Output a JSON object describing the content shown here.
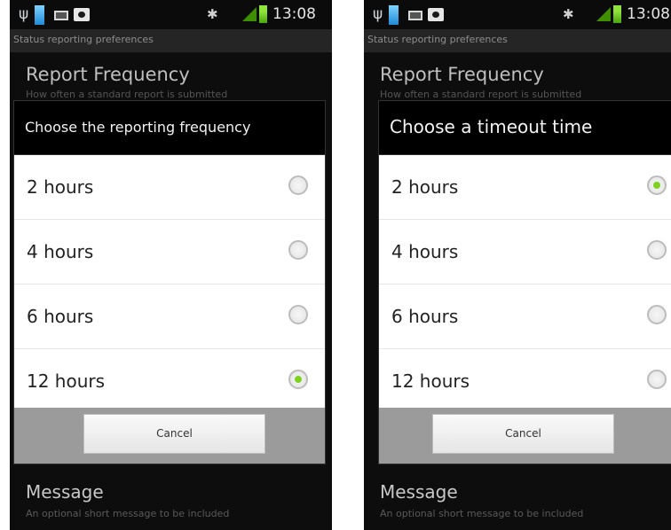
{
  "statusbar": {
    "time": "13:08"
  },
  "screen": {
    "app_title": "Status reporting preferences",
    "pref_title": "Report Frequency",
    "pref_summary": "How often a standard report is submitted",
    "message_title": "Message",
    "message_summary": "An optional short message to be included"
  },
  "left_dialog": {
    "title": "Choose the reporting frequency",
    "options": [
      "2 hours",
      "4 hours",
      "6 hours",
      "12 hours"
    ],
    "selected_index": 3,
    "cancel_label": "Cancel"
  },
  "right_dialog": {
    "title": "Choose a timeout time",
    "options": [
      "2 hours",
      "4 hours",
      "6 hours",
      "12 hours"
    ],
    "selected_index": 0,
    "cancel_label": "Cancel"
  },
  "colors": {
    "radio_selected": "#7ed321",
    "signal": "#3d8f00"
  }
}
